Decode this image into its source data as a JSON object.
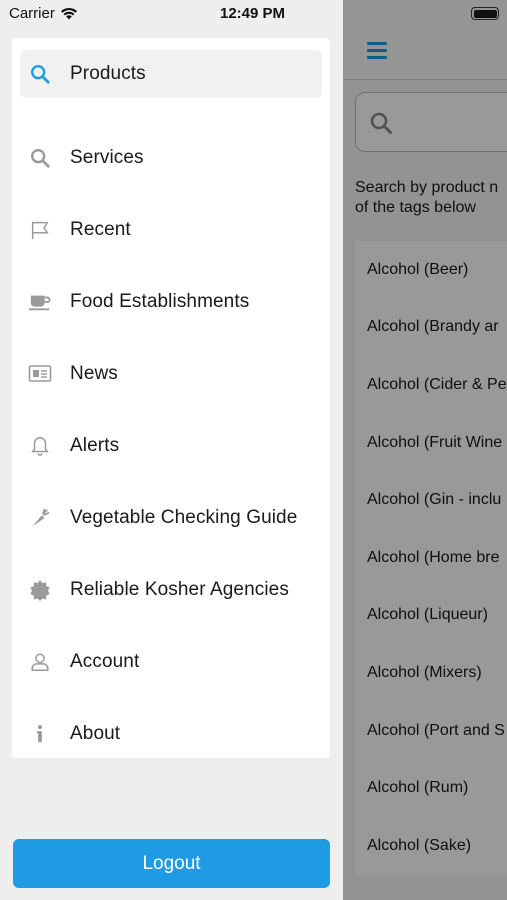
{
  "status_bar": {
    "carrier": "Carrier",
    "time": "12:49 PM"
  },
  "drawer": {
    "items": [
      {
        "label": "Products",
        "icon": "search-icon",
        "active": true
      },
      {
        "label": "Services",
        "icon": "search-icon"
      },
      {
        "label": "Recent",
        "icon": "flag-icon"
      },
      {
        "label": "Food Establishments",
        "icon": "coffee-cup-icon"
      },
      {
        "label": "News",
        "icon": "newspaper-icon"
      },
      {
        "label": "Alerts",
        "icon": "bell-icon"
      },
      {
        "label": "Vegetable Checking Guide",
        "icon": "carrot-icon"
      },
      {
        "label": "Reliable Kosher Agencies",
        "icon": "seal-icon"
      },
      {
        "label": "Account",
        "icon": "user-icon"
      },
      {
        "label": "About",
        "icon": "info-icon"
      }
    ],
    "logout_label": "Logout"
  },
  "main": {
    "hint_text": "Search by product n\nof the tags below",
    "tags": [
      "Alcohol (Beer)",
      "Alcohol (Brandy ar",
      "Alcohol (Cider & Pe",
      "Alcohol (Fruit Wine",
      "Alcohol (Gin - inclu",
      "Alcohol (Home bre",
      "Alcohol (Liqueur)",
      "Alcohol (Mixers)",
      "Alcohol (Port and S",
      "Alcohol (Rum)",
      "Alcohol (Sake)"
    ]
  },
  "colors": {
    "accent": "#1e9be3",
    "icon_gray": "#9a9a9a",
    "overlay": "rgba(0,0,0,0.4)"
  }
}
